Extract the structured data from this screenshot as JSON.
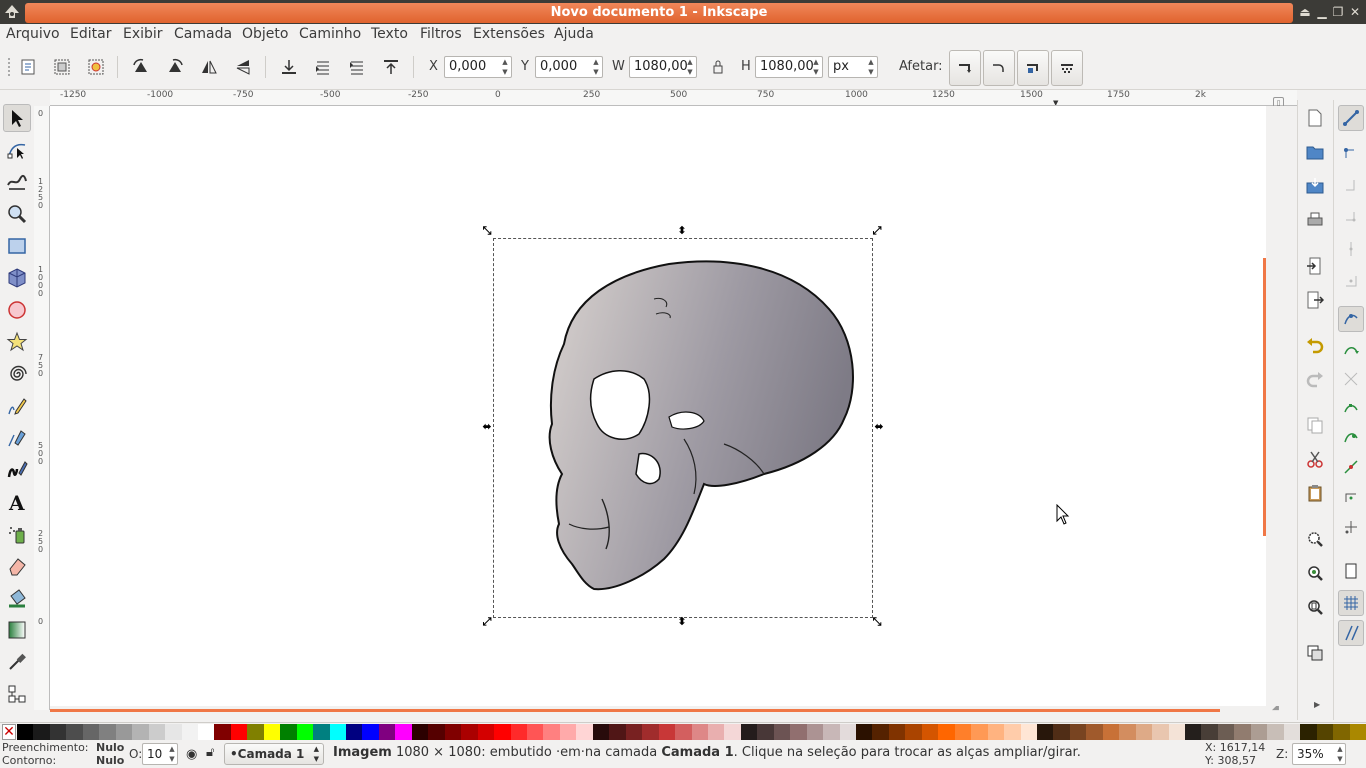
{
  "window": {
    "title": "Novo documento 1 - Inkscape"
  },
  "menu": [
    "Arquivo",
    "Editar",
    "Exibir",
    "Camada",
    "Objeto",
    "Caminho",
    "Texto",
    "Filtros",
    "Extensões",
    "Ajuda"
  ],
  "toolbar": {
    "x_label": "X",
    "x_value": "0,000",
    "y_label": "Y",
    "y_value": "0,000",
    "w_label": "W",
    "w_value": "1080,00",
    "h_label": "H",
    "h_value": "1080,00",
    "unit": "px",
    "affect_label": "Afetar:"
  },
  "ruler": {
    "h_ticks": [
      "-1250",
      "-1000",
      "-750",
      "-500",
      "-250",
      "0",
      "250",
      "500",
      "750",
      "1000",
      "1250",
      "1500",
      "1750",
      "2k"
    ],
    "v_ticks": [
      "0",
      "1\n2\n5\n0",
      "1\n0\n0\n0",
      "7\n5\n0",
      "5\n0\n0",
      "2\n5\n0",
      "0"
    ]
  },
  "status": {
    "fill_label": "Preenchimento:",
    "fill_value": "Nulo",
    "stroke_label": "Contorno:",
    "stroke_value": "Nulo",
    "opacity_label": "O:",
    "opacity_value": "10",
    "layer": "•Camada 1",
    "message_bold": "Imagem",
    "message_1": " 1080 × 1080: embutido ·em·na camada ",
    "message_layer": "Camada 1",
    "message_2": ". Clique na seleção para trocar as alças ampliar/girar.",
    "x_coord": "X: 1617,14",
    "y_coord": "Y:  308,57",
    "zoom_label": "Z:",
    "zoom": "35%"
  },
  "colors": {
    "accent": "#f07746",
    "titlebar": "#3c3b37"
  },
  "palette": [
    "#000000",
    "#1a1a1a",
    "#333333",
    "#4d4d4d",
    "#666666",
    "#808080",
    "#999999",
    "#b3b3b3",
    "#cccccc",
    "#e6e6e6",
    "#f2f2f2",
    "#ffffff",
    "#800000",
    "#ff0000",
    "#808000",
    "#ffff00",
    "#008000",
    "#00ff00",
    "#008080",
    "#00ffff",
    "#000080",
    "#0000ff",
    "#800080",
    "#ff00ff",
    "#2b0000",
    "#550000",
    "#800000",
    "#aa0000",
    "#d40000",
    "#ff0000",
    "#ff2a2a",
    "#ff5555",
    "#ff8080",
    "#ffaaaa",
    "#ffd5d5",
    "#280b0b",
    "#501616",
    "#782121",
    "#a02c2c",
    "#c83737",
    "#d35f5f",
    "#de8787",
    "#e9afaf",
    "#f4d7d7",
    "#241c1c",
    "#483737",
    "#6c5353",
    "#916f6f",
    "#ac9393",
    "#c8b7b7",
    "#e3dbdb",
    "#2b1100",
    "#552200",
    "#803300",
    "#aa4400",
    "#d45500",
    "#ff6600",
    "#ff7f2a",
    "#ff9955",
    "#ffb380",
    "#ffccaa",
    "#ffe6d5",
    "#28170b",
    "#502d16",
    "#784421",
    "#a05a2c",
    "#c87137",
    "#d38d5f",
    "#deaa87",
    "#e9c6af",
    "#f4e3d7",
    "#241f1c",
    "#483e37",
    "#6c5d53",
    "#917c6f",
    "#ac9d93",
    "#c8beb7",
    "#e3dedb",
    "#2b2200",
    "#554400",
    "#806600",
    "#aa8800"
  ]
}
